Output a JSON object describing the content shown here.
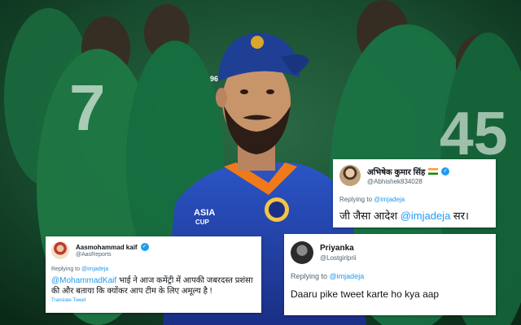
{
  "photo": {
    "description_icon": "cricket-player-photo",
    "jersey_texts": [
      "7",
      "45",
      "ASIA CUP"
    ]
  },
  "tweets": [
    {
      "name": "अभिषेक कुमार सिंह",
      "handle": "@Abhishek834028",
      "replying_label": "Replying to",
      "replying_to": "@imjadeja",
      "body_prefix": "जी जैसा आदेश ",
      "body_mention": "@imjadeja",
      "body_suffix": " सर।"
    },
    {
      "name": "Aasmohammad kaif",
      "handle": "@AasReports",
      "replying_label": "Replying to",
      "replying_to": "@imjadeja",
      "body_mention": "@MohammadKaif",
      "body_suffix": " भाई ने आज कमेंट्री में आपकी जबरदस्त प्रशंसा की और बताया कि क्योंकर आप टीम के लिए अमूल्य है !",
      "translate": "Translate Tweet"
    },
    {
      "name": "Priyanka",
      "handle": "@Lostgirlprii",
      "replying_label": "Replying to",
      "replying_to": "@imjadeja",
      "body": "Daaru pike tweet karte ho kya aap"
    }
  ],
  "colors": {
    "link": "#1d9bf0",
    "india_blue": "#1f3f94",
    "pakistan_green": "#0f6b3a"
  }
}
